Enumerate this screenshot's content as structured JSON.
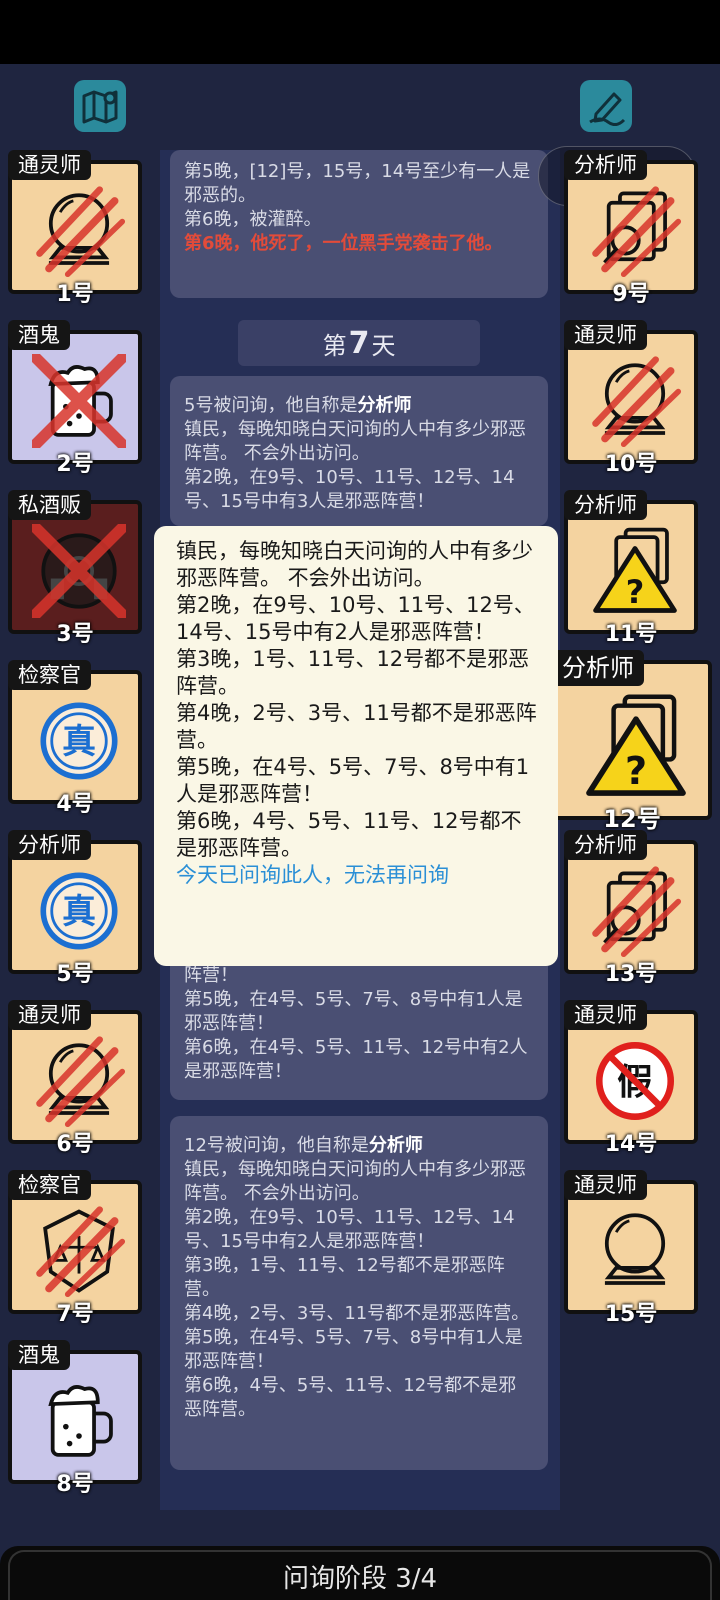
{
  "top": {
    "map_icon": "map-icon",
    "notes_icon": "pencil-icon"
  },
  "log": {
    "card_night": {
      "lines": [
        "第5晚，[12]号，15号，14号至少有一人是邪恶的。",
        "第6晚，被灌醉。"
      ],
      "death": "第6晚，他死了，一位黑手党袭击了他。"
    },
    "day": {
      "prefix": "第",
      "number": "7",
      "suffix": "天"
    },
    "card_5": {
      "header_pre": "5号被问询，他自称是",
      "header_role": "分析师",
      "body": "镇民，每晚知晓白天问询的人中有多少邪恶阵营。 不会外出访问。\n第2晚，在9号、10号、11号、12号、14号、15号中有3人是邪恶阵营！"
    },
    "card_hidden": {
      "body": "第4晚，在2号、3号、11号中有1人是邪恶阵营！\n第5晚，在4号、5号、7号、8号中有1人是邪恶阵营！\n第6晚，在4号、5号、11号、12号中有2人是邪恶阵营！"
    },
    "card_12": {
      "header_pre": "12号被问询，他自称是",
      "header_role": "分析师",
      "body": "镇民，每晚知晓白天问询的人中有多少邪恶阵营。 不会外出访问。\n第2晚，在9号、10号、11号、12号、14号、15号中有2人是邪恶阵营！\n第3晚，1号、11号、12号都不是邪恶阵营。\n第4晚，2号、3号、11号都不是邪恶阵营。\n第5晚，在4号、5号、7号、8号中有1人是邪恶阵营！\n第6晚，4号、5号、11号、12号都不是邪恶阵营。"
    }
  },
  "tooltip": {
    "body": "镇民，每晚知晓白天问询的人中有多少邪恶阵营。 不会外出访问。\n第2晚，在9号、10号、11号、12号、14号、15号中有2人是邪恶阵营！\n第3晚，1号、11号、12号都不是邪恶阵营。\n第4晚，2号、3号、11号都不是邪恶阵营。\n第5晚，在4号、5号、7号、8号中有1人是邪恶阵营！\n第6晚，4号、5号、11号、12号都不是邪恶阵营。",
    "notice": "今天已问询此人，无法再问询"
  },
  "players_left": [
    {
      "role": "通灵师",
      "num": "1号",
      "status": "dead"
    },
    {
      "role": "酒鬼",
      "num": "2号",
      "status": "eliminated"
    },
    {
      "role": "私酒贩",
      "num": "3号",
      "status": "eliminated"
    },
    {
      "role": "检察官",
      "num": "4号",
      "status": "verified"
    },
    {
      "role": "分析师",
      "num": "5号",
      "status": "verified"
    },
    {
      "role": "通灵师",
      "num": "6号",
      "status": "dead"
    },
    {
      "role": "检察官",
      "num": "7号",
      "status": "dead"
    },
    {
      "role": "酒鬼",
      "num": "8号",
      "status": "alive"
    }
  ],
  "players_right": [
    {
      "role": "分析师",
      "num": "9号",
      "status": "dead"
    },
    {
      "role": "通灵师",
      "num": "10号",
      "status": "dead"
    },
    {
      "role": "分析师",
      "num": "11号",
      "status": "unknown"
    },
    {
      "role": "分析师",
      "num": "12号",
      "status": "unknown-selected"
    },
    {
      "role": "分析师",
      "num": "13号",
      "status": "dead"
    },
    {
      "role": "通灵师",
      "num": "14号",
      "status": "fake"
    },
    {
      "role": "通灵师",
      "num": "15号",
      "status": "alive"
    }
  ],
  "phase": {
    "label": "问询阶段 3/4"
  },
  "colors": {
    "background": "#1f2540",
    "card": "#4a4f73",
    "tile": "#f4d3a0",
    "death_text": "#e34b3a",
    "notice": "#2a8fd6"
  }
}
